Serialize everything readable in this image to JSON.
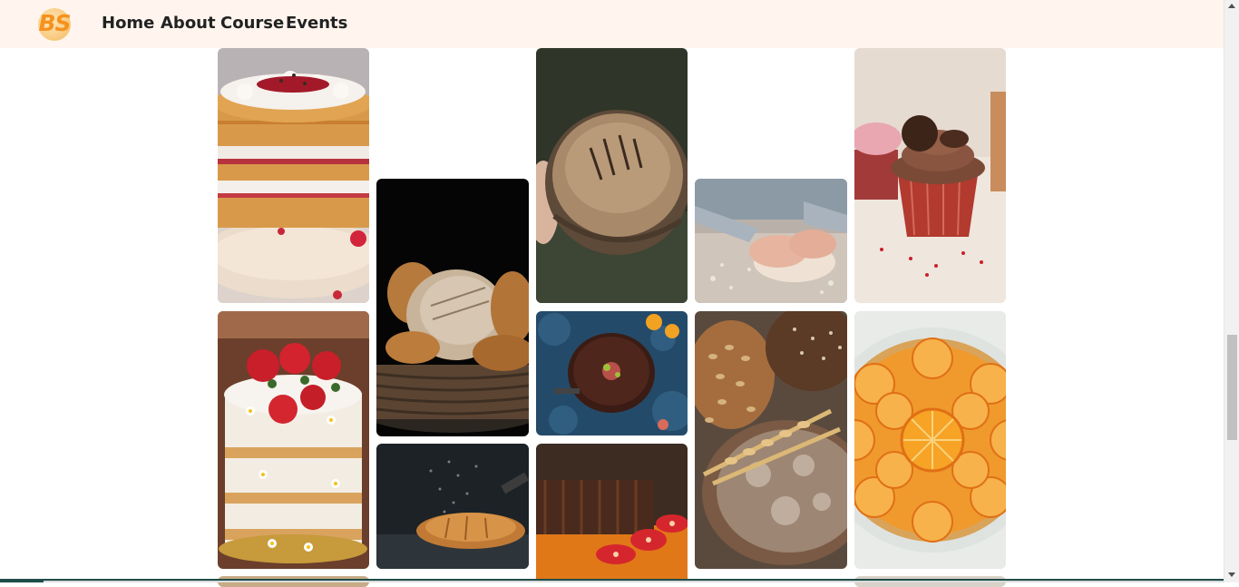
{
  "header": {
    "logo_text": "BS",
    "nav": {
      "home": "Home",
      "about": "About",
      "course": "Course",
      "events": "Events"
    }
  },
  "colors": {
    "header_bg": "#fff5ee",
    "logo_orange": "#f5921e",
    "nav_text": "#222222"
  },
  "gallery": {
    "images": [
      "layered-berry-cake",
      "bread-basket",
      "sourdough-loaf-held",
      "hands-kneading-dough",
      "chocolate-cupcake",
      "strawberry-naked-cake",
      "chocolate-tart",
      "rustic-breads-with-wheat",
      "orange-tart",
      "croissant-with-flour",
      "chocolate-strawberry-dessert"
    ]
  }
}
